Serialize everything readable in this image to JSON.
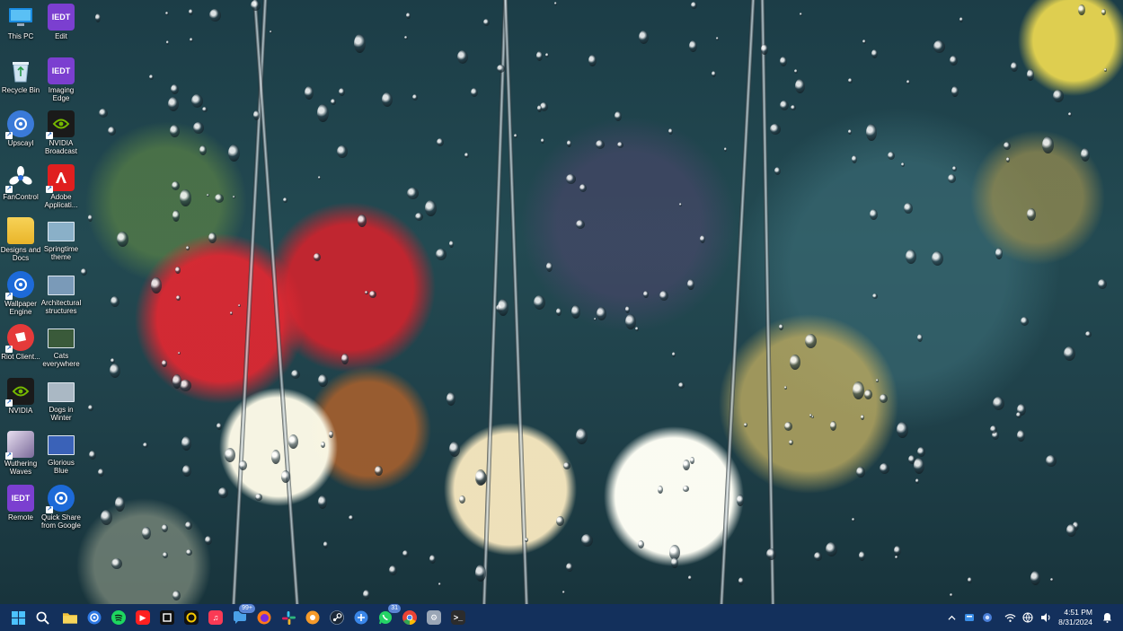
{
  "desktop": {
    "icons": [
      {
        "label": "This PC",
        "icon": "monitor-icon",
        "color": "#2a8fd8"
      },
      {
        "label": "Edit",
        "icon": "iedt-edit-icon",
        "color": "#7b3fd0"
      },
      {
        "label": "Recycle Bin",
        "icon": "recycle-bin-icon",
        "color": "#d8e4ee"
      },
      {
        "label": "Imaging Edge",
        "icon": "iedt-imaging-icon",
        "color": "#7b3fd0"
      },
      {
        "label": "Upscayl",
        "icon": "upscayl-icon",
        "color": "#3a7ad8"
      },
      {
        "label": "NVIDIA Broadcast",
        "icon": "nvidia-broadcast-icon",
        "color": "#1d2a1a"
      },
      {
        "label": "FanControl",
        "icon": "fan-icon",
        "color": "#ffffff"
      },
      {
        "label": "Adobe Applicati...",
        "icon": "adobe-icon",
        "color": "#e01f1f"
      },
      {
        "label": "Designs and Docs",
        "icon": "folder-icon",
        "color": "#f2c23a"
      },
      {
        "label": "Springtime theme",
        "icon": "springtime-theme-icon",
        "color": "#8ab0c8"
      },
      {
        "label": "Wallpaper Engine",
        "icon": "wallpaper-engine-icon",
        "color": "#1d6ad8"
      },
      {
        "label": "Architectural structures",
        "icon": "architectural-theme-icon",
        "color": "#7a9ab8"
      },
      {
        "label": "Riot Client...",
        "icon": "riot-icon",
        "color": "#e53a3a"
      },
      {
        "label": "Cats everywhere",
        "icon": "cats-theme-icon",
        "color": "#3a5a3a"
      },
      {
        "label": "NVIDIA",
        "icon": "nvidia-icon",
        "color": "#76b900"
      },
      {
        "label": "Dogs in Winter",
        "icon": "dogs-theme-icon",
        "color": "#aab8c4"
      },
      {
        "label": "Wuthering Waves",
        "icon": "wuthering-waves-icon",
        "color": "#cfc4d8"
      },
      {
        "label": "Glorious Blue",
        "icon": "glorious-blue-theme-icon",
        "color": "#3a62b8"
      },
      {
        "label": "Remote",
        "icon": "iedt-remote-icon",
        "color": "#7b3fd0"
      },
      {
        "label": "Quick Share from Google",
        "icon": "quick-share-icon",
        "color": "#1d6ad8"
      }
    ],
    "iedt_text": "IEDT"
  },
  "taskbar": {
    "apps": [
      {
        "name": "start-button",
        "icon": "windows-icon",
        "glyph": "",
        "color": "#4cc2ff"
      },
      {
        "name": "search-button",
        "icon": "search-icon",
        "glyph": "",
        "color": "#ffffff"
      },
      {
        "name": "file-explorer-button",
        "icon": "folder-icon",
        "glyph": "",
        "color": "#f2c23a"
      },
      {
        "name": "quick-share-button",
        "icon": "quick-share-icon",
        "glyph": "",
        "color": "#2f7ae5"
      },
      {
        "name": "spotify-button",
        "icon": "spotify-icon",
        "glyph": "",
        "color": "#1ed760"
      },
      {
        "name": "youtube-button",
        "icon": "youtube-icon",
        "glyph": "▶",
        "color": "#ff2020"
      },
      {
        "name": "app-button",
        "icon": "app-icon",
        "glyph": "",
        "color": "#111111"
      },
      {
        "name": "app-button-2",
        "icon": "ring-app-icon",
        "glyph": "",
        "color": "#f5c800"
      },
      {
        "name": "music-button",
        "icon": "apple-music-icon",
        "glyph": "♫",
        "color": "#fa3a55"
      },
      {
        "name": "messages-button",
        "icon": "chat-icon",
        "glyph": "",
        "color": "#4aa0e8",
        "badge": "99+"
      },
      {
        "name": "firefox-button",
        "icon": "firefox-icon",
        "glyph": "",
        "color": "#ff7a1a"
      },
      {
        "name": "slack-button",
        "icon": "slack-icon",
        "glyph": "",
        "color": "#ffffff"
      },
      {
        "name": "app-button-3",
        "icon": "orange-app-icon",
        "glyph": "",
        "color": "#f59a2a"
      },
      {
        "name": "steam-button",
        "icon": "steam-icon",
        "glyph": "",
        "color": "#1b2838"
      },
      {
        "name": "app-button-4",
        "icon": "blue-app-icon",
        "glyph": "",
        "color": "#3a86e8"
      },
      {
        "name": "whatsapp-button",
        "icon": "whatsapp-icon",
        "glyph": "",
        "color": "#25d366",
        "badge": "31"
      },
      {
        "name": "chrome-button",
        "icon": "chrome-icon",
        "glyph": "",
        "color": "#ea4335"
      },
      {
        "name": "settings-button",
        "icon": "gear-icon",
        "glyph": "⚙",
        "color": "#9aa6b6"
      },
      {
        "name": "terminal-button",
        "icon": "terminal-icon",
        "glyph": ">_",
        "color": "#2c2c2c"
      }
    ],
    "tray": {
      "time": "4:51 PM",
      "date": "8/31/2024"
    }
  }
}
